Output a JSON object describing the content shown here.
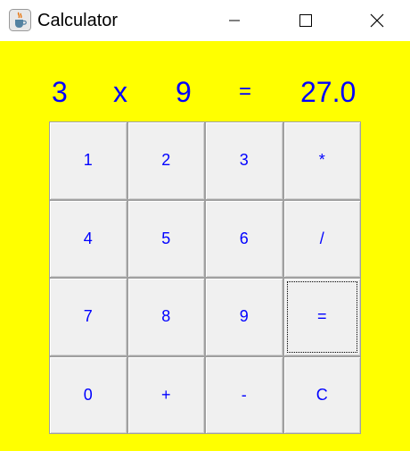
{
  "window": {
    "title": "Calculator",
    "icon": "java-cup-icon",
    "controls": [
      "minimize-icon",
      "maximize-icon",
      "close-icon"
    ]
  },
  "colors": {
    "background": "#ffff00",
    "text": "#0000ff",
    "button_face": "#f0f0f0"
  },
  "display": {
    "operand1": "3",
    "operator": "x",
    "operand2": "9",
    "equals": "=",
    "result": "27.0"
  },
  "keypad": {
    "keys": [
      "1",
      "2",
      "3",
      "*",
      "4",
      "5",
      "6",
      "/",
      "7",
      "8",
      "9",
      "=",
      "0",
      "+",
      "-",
      "C"
    ],
    "focused_key": "="
  }
}
